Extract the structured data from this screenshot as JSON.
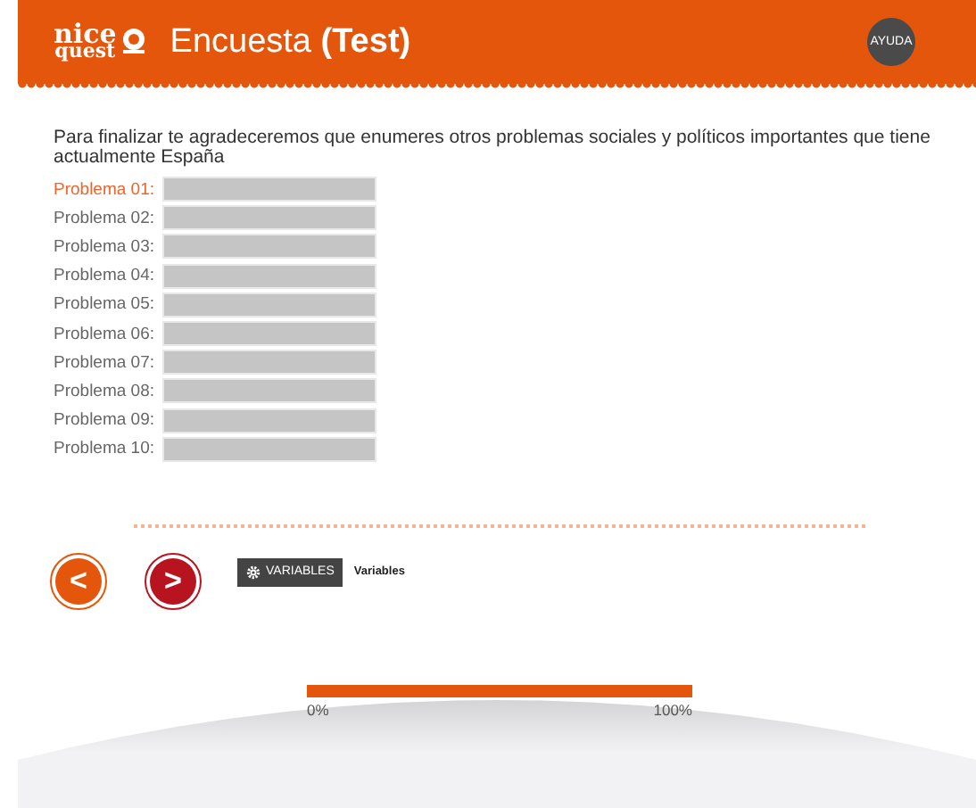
{
  "header": {
    "logo": {
      "line1": "nice",
      "line2": "quest"
    },
    "title": "Encuesta **(Test)**",
    "help_button": "AYUDA"
  },
  "question": "Para finalizar te agradeceremos que enumeres otros problemas sociales y políticos importantes que tiene actualmente España",
  "answers": [
    {
      "label": "Problema 01:",
      "selected": true
    },
    {
      "label": "Problema 02:",
      "selected": false
    },
    {
      "label": "Problema 03:",
      "selected": false
    },
    {
      "label": "Problema 04:",
      "selected": false
    },
    {
      "label": "Problema 05:",
      "selected": false
    },
    {
      "label": "Problema 06:",
      "selected": false
    },
    {
      "label": "Problema 07:",
      "selected": false
    },
    {
      "label": "Problema 08:",
      "selected": false
    },
    {
      "label": "Problema 09:",
      "selected": false
    },
    {
      "label": "Problema 10:",
      "selected": false
    }
  ],
  "navigation": {
    "back_button": "<",
    "next_button": ">",
    "variables_button": "VARIABLES",
    "variables_label": "Variables"
  },
  "progress": {
    "level": 1,
    "start_label": "0%",
    "end_label": "100%"
  }
}
